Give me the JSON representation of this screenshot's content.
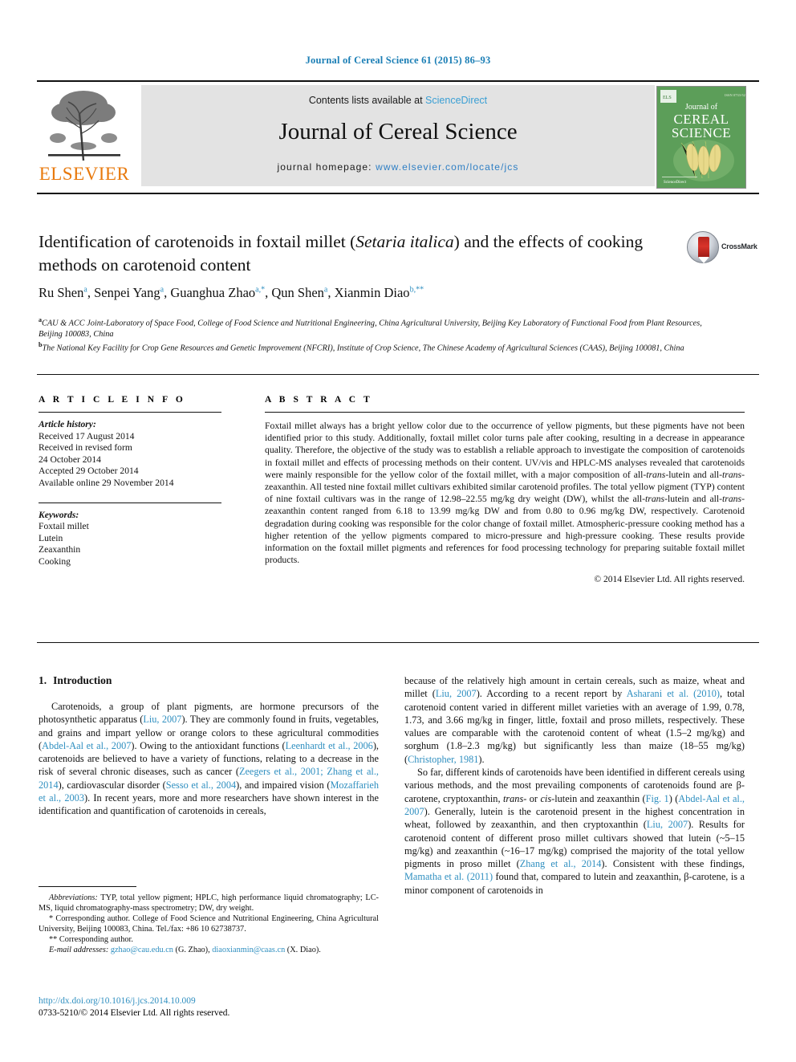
{
  "running_head": "Journal of Cereal Science 61 (2015) 86–93",
  "masthead": {
    "contents_prefix": "Contents lists available at ",
    "sciencedirect": "ScienceDirect",
    "journal_name": "Journal of Cereal Science",
    "homepage_prefix": "journal homepage: ",
    "homepage_url": "www.elsevier.com/locate/jcs",
    "publisher": "ELSEVIER",
    "cover": {
      "line1": "Journal of",
      "line2": "CEREAL",
      "line3": "SCIENCE",
      "color": "#5c9e59"
    },
    "link_color": "#3a9fd4"
  },
  "article": {
    "title_part1": "Identification of carotenoids in foxtail millet (",
    "title_italic": "Setaria italica",
    "title_part2": ") and the effects of cooking methods on carotenoid content",
    "crossmark_label": "CrossMark",
    "authors": "Ru Shen a, Senpei Yang a, Guanghua Zhao a,*, Qun Shen a, Xianmin Diao b,**",
    "author_list": [
      {
        "name": "Ru Shen",
        "marks": "a"
      },
      {
        "name": "Senpei Yang",
        "marks": "a"
      },
      {
        "name": "Guanghua Zhao",
        "marks": "a,*"
      },
      {
        "name": "Qun Shen",
        "marks": "a"
      },
      {
        "name": "Xianmin Diao",
        "marks": "b,**"
      }
    ],
    "affiliations": [
      {
        "mark": "a",
        "text": "CAU & ACC Joint-Laboratory of Space Food, College of Food Science and Nutritional Engineering, China Agricultural University, Beijing Key Laboratory of Functional Food from Plant Resources, Beijing 100083, China"
      },
      {
        "mark": "b",
        "text": "The National Key Facility for Crop Gene Resources and Genetic Improvement (NFCRI), Institute of Crop Science, The Chinese Academy of Agricultural Sciences (CAAS), Beijing 100081, China"
      }
    ]
  },
  "article_info": {
    "heading": "A R T I C L E   I N F O",
    "history_label": "Article history:",
    "history": [
      "Received 17 August 2014",
      "Received in revised form",
      "24 October 2014",
      "Accepted 29 October 2014",
      "Available online 29 November 2014"
    ],
    "keywords_label": "Keywords:",
    "keywords": [
      "Foxtail millet",
      "Lutein",
      "Zeaxanthin",
      "Cooking"
    ]
  },
  "abstract": {
    "heading": "A B S T R A C T",
    "text_1": "Foxtail millet always has a bright yellow color due to the occurrence of yellow pigments, but these pigments have not been identified prior to this study. Additionally, foxtail millet color turns pale after cooking, resulting in a decrease in appearance quality. Therefore, the objective of the study was to establish a reliable approach to investigate the composition of carotenoids in foxtail millet and effects of processing methods on their content. UV/vis and HPLC-MS analyses revealed that carotenoids were mainly responsible for the yellow color of the foxtail millet, with a major composition of all-",
    "ital_1": "trans",
    "text_2": "-lutein and all-",
    "ital_2": "trans",
    "text_3": "-zeaxanthin. All tested nine foxtail millet cultivars exhibited similar carotenoid profiles. The total yellow pigment (TYP) content of nine foxtail cultivars was in the range of 12.98–22.55 mg/kg dry weight (DW), whilst the all-",
    "ital_3": "trans",
    "text_4": "-lutein and all-",
    "ital_4": "trans",
    "text_5": "-zeaxanthin content ranged from 6.18 to 13.99 mg/kg DW and from 0.80 to 0.96 mg/kg DW, respectively. Carotenoid degradation during cooking was responsible for the color change of foxtail millet. Atmospheric-pressure cooking method has a higher retention of the yellow pigments compared to micro-pressure and high-pressure cooking. These results provide information on the foxtail millet pigments and references for food processing technology for preparing suitable foxtail millet products.",
    "copyright": "© 2014 Elsevier Ltd. All rights reserved."
  },
  "introduction": {
    "heading_number": "1.",
    "heading_text": "Introduction",
    "left_p1_a": "Carotenoids, a group of plant pigments, are hormone precursors of the photosynthetic apparatus (",
    "left_ref1": "Liu, 2007",
    "left_p1_b": "). They are commonly found in fruits, vegetables, and grains and impart yellow or orange colors to these agricultural commodities (",
    "left_ref2": "Abdel-Aal et al., 2007",
    "left_p1_c": "). Owing to the antioxidant functions (",
    "left_ref3": "Leenhardt et al., 2006",
    "left_p1_d": "), carotenoids are believed to have a variety of functions, relating to a decrease in the risk of several chronic diseases, such as cancer (",
    "left_ref4": "Zeegers et al., 2001; Zhang et al., 2014",
    "left_p1_e": "), cardiovascular disorder (",
    "left_ref5": "Sesso et al., 2004",
    "left_p1_f": "), and impaired vision (",
    "left_ref6": "Mozaffarieh et al., 2003",
    "left_p1_g": "). In recent years, more and more researchers have shown interest in the identification and quantification of carotenoids in cereals,",
    "right_p1_a": "because of the relatively high amount in certain cereals, such as maize, wheat and millet (",
    "right_ref1": "Liu, 2007",
    "right_p1_b": "). According to a recent report by ",
    "right_ref2": "Asharani et al. (2010)",
    "right_p1_c": ", total carotenoid content varied in different millet varieties with an average of 1.99, 0.78, 1.73, and 3.66 mg/kg in finger, little, foxtail and proso millets, respectively. These values are comparable with the carotenoid content of wheat (1.5–2 mg/kg) and sorghum (1.8–2.3 mg/kg) but significantly less than maize (18–55 mg/kg) (",
    "right_ref3": "Christopher, 1981",
    "right_p1_d": ").",
    "right_p2_a": "So far, different kinds of carotenoids have been identified in different cereals using various methods, and the most prevailing components of carotenoids found are β-carotene, cryptoxanthin, ",
    "right_p2_ital1": "trans",
    "right_p2_b": "- or ",
    "right_p2_ital2": "cis",
    "right_p2_c": "-lutein and zeaxanthin (",
    "right_ref4": "Fig. 1",
    "right_p2_d": ") (",
    "right_ref5": "Abdel-Aal et al., 2007",
    "right_p2_e": "). Generally, lutein is the carotenoid present in the highest concentration in wheat, followed by zeaxanthin, and then cryptoxanthin (",
    "right_ref6": "Liu, 2007",
    "right_p2_f": "). Results for carotenoid content of different proso millet cultivars showed that lutein (~5–15 mg/kg) and zeaxanthin (~16–17 mg/kg) comprised the majority of the total yellow pigments in proso millet (",
    "right_ref7": "Zhang et al., 2014",
    "right_p2_g": "). Consistent with these findings, ",
    "right_ref8": "Mamatha et al. (2011)",
    "right_p2_h": " found that, compared to lutein and zeaxanthin, β-carotene, is a minor component of carotenoids in"
  },
  "footnotes": {
    "abbreviations_label": "Abbreviations:",
    "abbreviations_text": " TYP, total yellow pigment; HPLC, high performance liquid chromatography; LC-MS, liquid chromatography-mass spectrometry; DW, dry weight.",
    "corresponding_1_mark": "*",
    "corresponding_1": " Corresponding author. College of Food Science and Nutritional Engineering, China Agricultural University, Beijing 100083, China. Tel./fax: +86 10 62738737.",
    "corresponding_2_mark": "**",
    "corresponding_2": " Corresponding author.",
    "email_label": "E-mail addresses:",
    "email_1": "gzhao@cau.edu.cn",
    "email_1_owner": " (G. Zhao), ",
    "email_2": "diaoxianmin@caas.cn",
    "email_2_owner": " (X. Diao)."
  },
  "footer": {
    "doi": "http://dx.doi.org/10.1016/j.jcs.2014.10.009",
    "issn_line": "0733-5210/© 2014 Elsevier Ltd. All rights reserved."
  }
}
